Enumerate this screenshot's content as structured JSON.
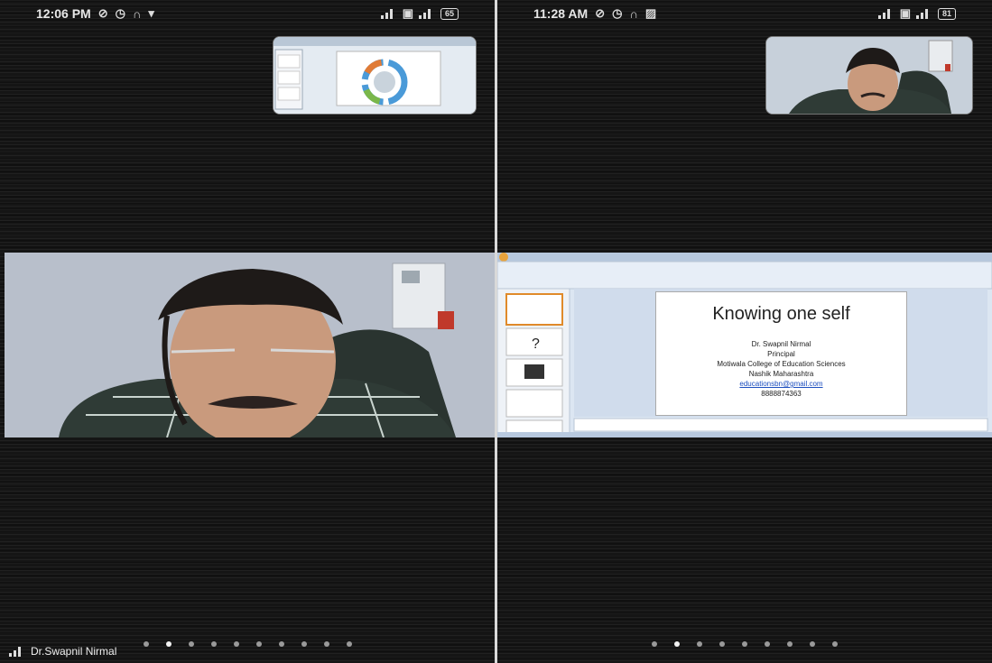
{
  "left": {
    "status": {
      "time": "12:06 PM",
      "battery": "65"
    },
    "participant_name": "Dr.Swapnil Nirmal",
    "page_dots": 10,
    "active_dot": 1
  },
  "right": {
    "status": {
      "time": "11:28 AM",
      "battery": "81"
    },
    "page_dots": 9,
    "active_dot": 1,
    "slide": {
      "title": "Knowing one self",
      "lines": [
        "Dr. Swapnil Nirmal",
        "Principal",
        "Motiwala College of Education Sciences",
        "Nashik Maharashtra"
      ],
      "email": "educationsbn@gmail.com",
      "phone": "8888874363"
    }
  }
}
